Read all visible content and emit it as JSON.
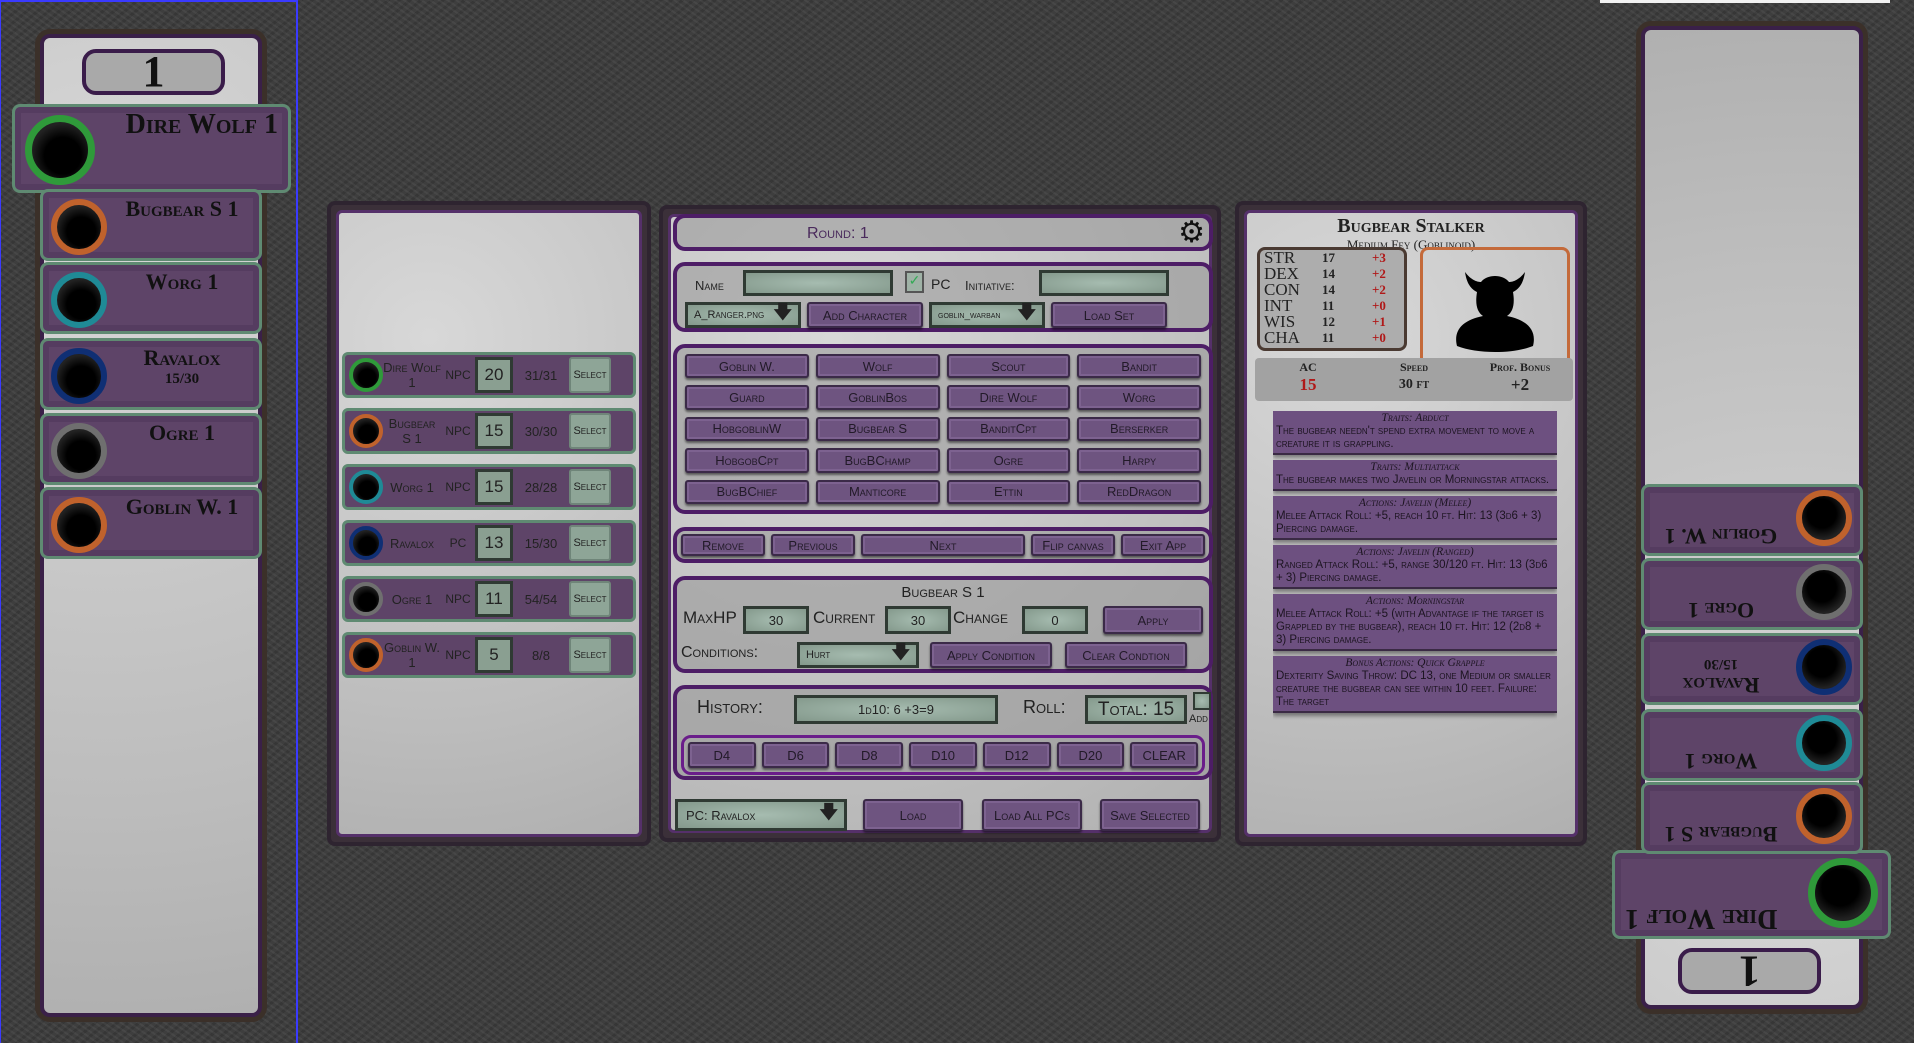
{
  "colors": {
    "accent": "#4d1d66",
    "button": "#6e5480",
    "input": "#8ea597",
    "mod": "#b01818"
  },
  "left_sidebar": {
    "counter": "1",
    "tokens": [
      {
        "name": "Dire Wolf 1",
        "hp": "",
        "color": "#2f9a3a",
        "icon": "wolf-icon",
        "active": true
      },
      {
        "name": "Bugbear S 1",
        "hp": "",
        "color": "#c0622c",
        "icon": "bugbear-icon"
      },
      {
        "name": "Worg 1",
        "hp": "",
        "color": "#1f8a96",
        "icon": "worg-icon"
      },
      {
        "name": "Ravalox",
        "hp": "15/30",
        "color": "#0f2f74",
        "icon": "bow-arrow-icon"
      },
      {
        "name": "Ogre 1",
        "hp": "",
        "color": "#6f6f6f",
        "icon": "ogre-icon"
      },
      {
        "name": "Goblin W. 1",
        "hp": "",
        "color": "#c0622c",
        "icon": "goblin-icon"
      }
    ]
  },
  "right_sidebar": {
    "counter": "1",
    "tokens": [
      {
        "name": "Dire Wolf 1",
        "hp": "",
        "color": "#2f9a3a",
        "icon": "wolf-icon",
        "active": true
      },
      {
        "name": "Bugbear S 1",
        "hp": "",
        "color": "#c0622c",
        "icon": "bugbear-icon"
      },
      {
        "name": "Worg 1",
        "hp": "",
        "color": "#1f8a96",
        "icon": "worg-icon"
      },
      {
        "name": "Ravalox",
        "hp": "15/30",
        "color": "#0f2f74",
        "icon": "bow-arrow-icon"
      },
      {
        "name": "Ogre 1",
        "hp": "",
        "color": "#6f6f6f",
        "icon": "ogre-icon"
      },
      {
        "name": "Goblin W. 1",
        "hp": "",
        "color": "#c0622c",
        "icon": "goblin-icon"
      }
    ]
  },
  "initiative_list": [
    {
      "name": "Dire Wolf 1",
      "type": "NPC",
      "init": "20",
      "hp": "31/31",
      "select": "Select",
      "color": "#2f9a3a"
    },
    {
      "name": "Bugbear S 1",
      "type": "NPC",
      "init": "15",
      "hp": "30/30",
      "select": "Select",
      "color": "#c0622c"
    },
    {
      "name": "Worg 1",
      "type": "NPC",
      "init": "15",
      "hp": "28/28",
      "select": "Select",
      "color": "#1f8a96"
    },
    {
      "name": "Ravalox",
      "type": "PC",
      "init": "13",
      "hp": "15/30",
      "select": "Select",
      "color": "#0f2f74"
    },
    {
      "name": "Ogre 1",
      "type": "NPC",
      "init": "11",
      "hp": "54/54",
      "select": "Select",
      "color": "#6f6f6f"
    },
    {
      "name": "Goblin W. 1",
      "type": "NPC",
      "init": "5",
      "hp": "8/8",
      "select": "Select",
      "color": "#c0622c"
    }
  ],
  "control": {
    "round": "Round: 1",
    "name_label": "Name",
    "name_value": "",
    "pc_label": "PC",
    "pc_checked": true,
    "initiative_label": "Initiative:",
    "initiative_value": "",
    "image_select": "A_Ranger.png",
    "add_character": "Add Character",
    "set_select": "goblin_warban",
    "load_set": "Load Set",
    "presets": [
      "Goblin W.",
      "Wolf",
      "Scout",
      "Bandit",
      "Guard",
      "GoblinBos",
      "Dire Wolf",
      "Worg",
      "HobgoblinW",
      "Bugbear S",
      "BanditCpt",
      "Berserker",
      "HobgobCpt",
      "BugBChamp",
      "Ogre",
      "Harpy",
      "BugBChief",
      "Manticore",
      "Ettin",
      "RedDragon"
    ],
    "actions": [
      "Remove",
      "Previous",
      "Next",
      "Flip canvas",
      "Exit App"
    ],
    "selected": {
      "name": "Bugbear S 1",
      "maxhp_label": "MaxHP",
      "maxhp": "30",
      "current_label": "Current",
      "current": "30",
      "change_label": "Change",
      "change": "0",
      "apply": "Apply",
      "conditions_label": "Conditions:",
      "condition": "Hurt",
      "apply_condition": "Apply Condition",
      "clear_condition": "Clear Condtion"
    },
    "dice": {
      "history_label": "History:",
      "history": "1d10: 6 +3=9",
      "roll_label": "Roll:",
      "total": "Total: 15",
      "add_label": "Add",
      "buttons": [
        "D4",
        "D6",
        "D8",
        "D10",
        "D12",
        "D20",
        "CLEAR"
      ]
    },
    "pc_select": "PC: Ravalox",
    "load": "Load",
    "load_all": "Load All PCs",
    "save_selected": "Save Selected"
  },
  "statblock": {
    "name": "Bugbear Stalker",
    "type": "Medium Fey (Goblinoid)",
    "abilities": [
      {
        "k": "STR",
        "v": "17",
        "m": "+3"
      },
      {
        "k": "DEX",
        "v": "14",
        "m": "+2"
      },
      {
        "k": "CON",
        "v": "14",
        "m": "+2"
      },
      {
        "k": "INT",
        "v": "11",
        "m": "+0"
      },
      {
        "k": "WIS",
        "v": "12",
        "m": "+1"
      },
      {
        "k": "CHA",
        "v": "11",
        "m": "+0"
      }
    ],
    "ac_label": "AC",
    "ac": "15",
    "speed_label": "Speed",
    "speed": "30 ft",
    "prof_label": "Prof. Bonus",
    "prof": "+2",
    "traits": [
      {
        "title": "Traits: Abduct",
        "text": "The bugbear needn't spend extra movement to move a creature it is grappling."
      },
      {
        "title": "Traits: Multiattack",
        "text": "The bugbear makes two Javelin or Morningstar attacks."
      },
      {
        "title": "Actions: Javelin (Melee)",
        "text": "Melee Attack Roll: +5, reach 10 ft. Hit: 13 (3d6 + 3) Piercing damage."
      },
      {
        "title": "Actions: Javelin (Ranged)",
        "text": "Ranged Attack Roll: +5, range 30/120 ft. Hit: 13 (3d6 + 3) Piercing damage."
      },
      {
        "title": "Actions: Morningstar",
        "text": "Melee Attack Roll: +5 (with Advantage if the target is Grappled by the bugbear), reach 10 ft. Hit: 12 (2d8 + 3) Piercing damage."
      },
      {
        "title": "Bonus Actions: Quick Grapple",
        "text": "Dexterity Saving Throw: DC 13, one Medium or smaller creature the bugbear can see within 10 feet. Failure: The target"
      }
    ]
  }
}
